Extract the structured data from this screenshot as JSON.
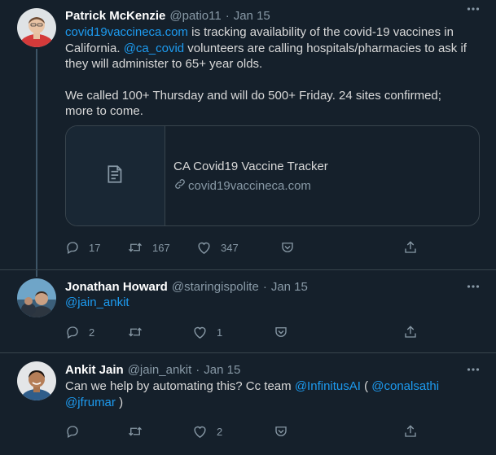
{
  "tweets": [
    {
      "name": "Patrick McKenzie",
      "handle": "@patio11",
      "dot": "·",
      "date": "Jan 15",
      "text": {
        "link1": "covid19vaccineca.com",
        "t1": " is tracking availability of the covid-19 vaccines in California. ",
        "link2": "@ca_covid",
        "t2": " volunteers are calling hospitals/pharmacies to ask if they will administer to 65+ year olds.",
        "para2": "We called 100+ Thursday and will do 500+ Friday. 24 sites confirmed; more to come."
      },
      "card": {
        "title": "CA Covid19 Vaccine Tracker",
        "url": "covid19vaccineca.com"
      },
      "replies": "17",
      "retweets": "167",
      "likes": "347"
    },
    {
      "name": "Jonathan Howard",
      "handle": "@staringispolite",
      "dot": "·",
      "date": "Jan 15",
      "text": {
        "link1": "@jain_ankit"
      },
      "replies": "2",
      "retweets": "",
      "likes": "1"
    },
    {
      "name": "Ankit Jain",
      "handle": "@jain_ankit",
      "dot": "·",
      "date": "Jan 15",
      "text": {
        "t1": "Can we help by automating this? Cc team ",
        "link1": "@InfinitusAI",
        "t2": " ( ",
        "link2": "@conalsathi",
        "link3": "@jfrumar",
        "t3": " )"
      },
      "replies": "",
      "retweets": "",
      "likes": "2"
    }
  ],
  "icons": {
    "more": "more-horizontal-icon",
    "reply": "reply-icon",
    "retweet": "retweet-icon",
    "like": "heart-icon",
    "bookmark": "bookmark-icon",
    "share": "share-icon",
    "card_thumb": "document-icon",
    "url": "link-icon"
  },
  "colors": {
    "background": "#15202b",
    "link": "#1d9bf0",
    "muted": "#8899a6",
    "border": "#38444d"
  }
}
